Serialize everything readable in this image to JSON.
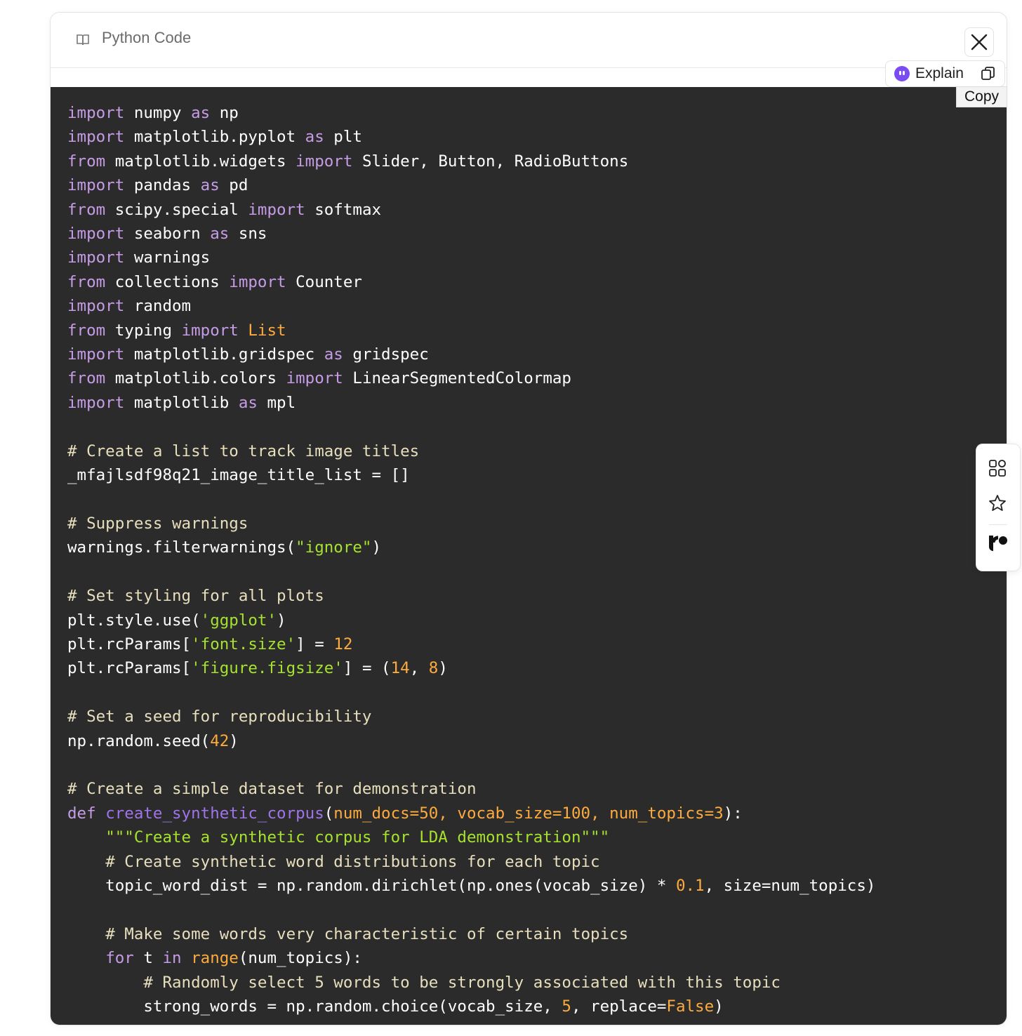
{
  "header": {
    "title": "Python Code",
    "book_icon": "book-open-icon",
    "close_icon": "close-icon"
  },
  "toolbar": {
    "explain_label": "Explain",
    "copy_icon": "copy-icon",
    "copy_tooltip": "Copy",
    "accent": "#7b4cf2"
  },
  "sidebar": {
    "icons": [
      "apps-grid-icon",
      "star-icon",
      "logo-icon"
    ]
  },
  "code": {
    "language": "python",
    "colors": {
      "background": "#2b2b2b",
      "keyword": "#c79ce6",
      "comment": "#e8dfbd",
      "string": "#a6e22e",
      "number": "#fdab3d",
      "function": "#a074e8",
      "text": "#ffffff"
    },
    "lines": [
      "import numpy as np",
      "import matplotlib.pyplot as plt",
      "from matplotlib.widgets import Slider, Button, RadioButtons",
      "import pandas as pd",
      "from scipy.special import softmax",
      "import seaborn as sns",
      "import warnings",
      "from collections import Counter",
      "import random",
      "from typing import List",
      "import matplotlib.gridspec as gridspec",
      "from matplotlib.colors import LinearSegmentedColormap",
      "import matplotlib as mpl",
      "",
      "# Create a list to track image titles",
      "_mfajlsdf98q21_image_title_list = []",
      "",
      "# Suppress warnings",
      "warnings.filterwarnings(\"ignore\")",
      "",
      "# Set styling for all plots",
      "plt.style.use('ggplot')",
      "plt.rcParams['font.size'] = 12",
      "plt.rcParams['figure.figsize'] = (14, 8)",
      "",
      "# Set a seed for reproducibility",
      "np.random.seed(42)",
      "",
      "# Create a simple dataset for demonstration",
      "def create_synthetic_corpus(num_docs=50, vocab_size=100, num_topics=3):",
      "    \"\"\"Create a synthetic corpus for LDA demonstration\"\"\"",
      "    # Create synthetic word distributions for each topic",
      "    topic_word_dist = np.random.dirichlet(np.ones(vocab_size) * 0.1, size=num_topics)",
      "",
      "    # Make some words very characteristic of certain topics",
      "    for t in range(num_topics):",
      "        # Randomly select 5 words to be strongly associated with this topic",
      "        strong_words = np.random.choice(vocab_size, 5, replace=False)"
    ]
  }
}
